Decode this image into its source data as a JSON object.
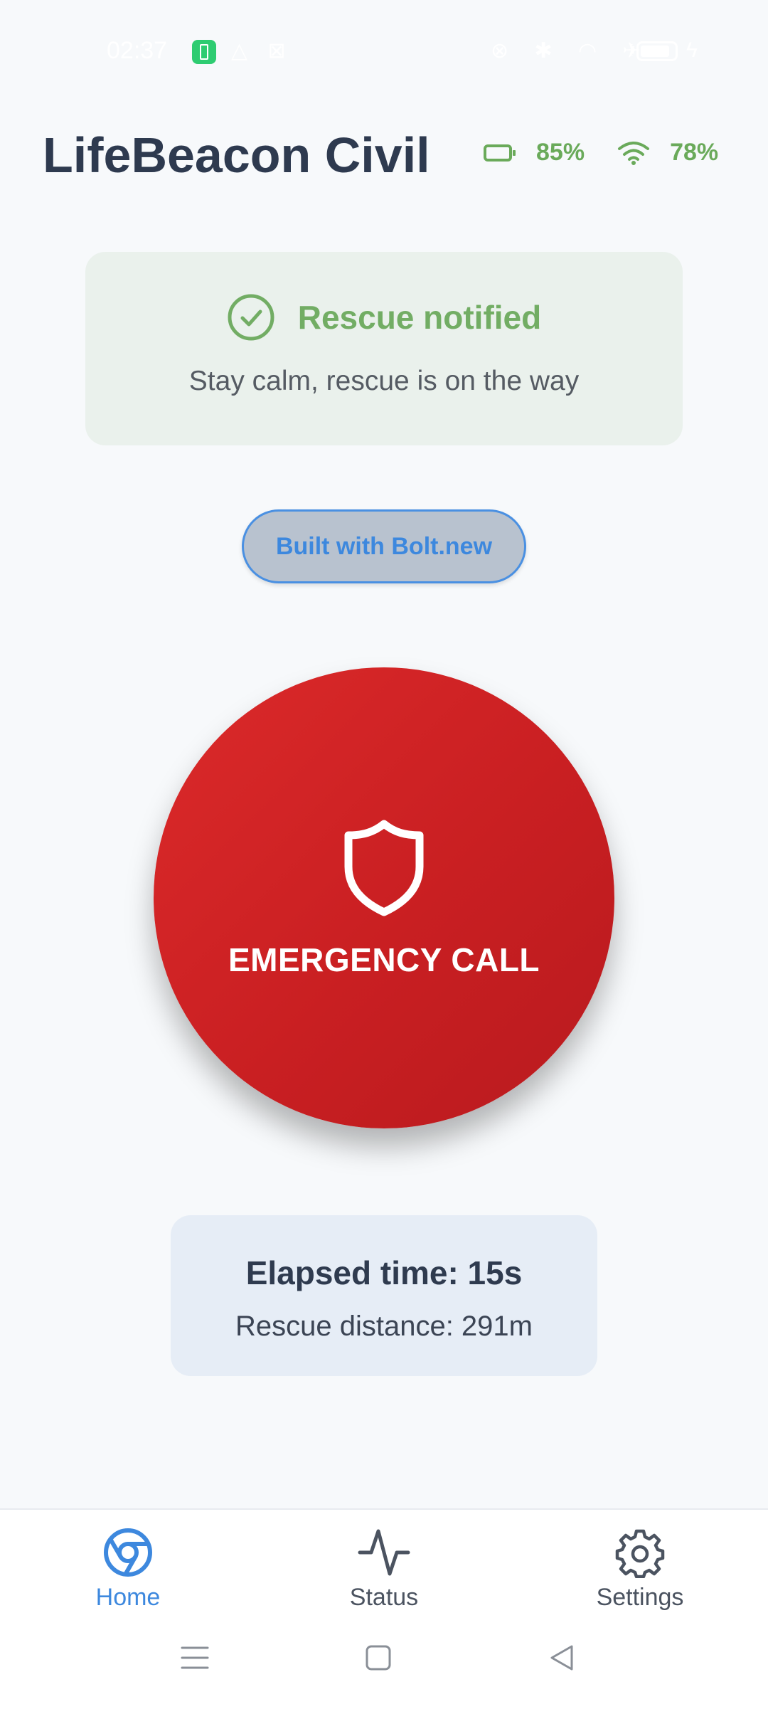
{
  "status_bar": {
    "time": "02:37"
  },
  "header": {
    "title": "LifeBeacon Civil",
    "battery": "85%",
    "signal": "78%"
  },
  "notice": {
    "title": "Rescue notified",
    "subtitle": "Stay calm, rescue is on the way"
  },
  "badge": {
    "label": "Built with Bolt.new"
  },
  "emergency": {
    "label": "EMERGENCY CALL"
  },
  "info": {
    "elapsed": "Elapsed time: 15s",
    "distance": "Rescue distance: 291m"
  },
  "nav": {
    "items": [
      {
        "label": "Home",
        "icon": "chrome-icon",
        "active": true
      },
      {
        "label": "Status",
        "icon": "activity-icon",
        "active": false
      },
      {
        "label": "Settings",
        "icon": "gear-icon",
        "active": false
      }
    ]
  },
  "colors": {
    "accent_blue": "#3d88de",
    "success_green": "#72ad64",
    "emergency_red": "#d12323"
  }
}
